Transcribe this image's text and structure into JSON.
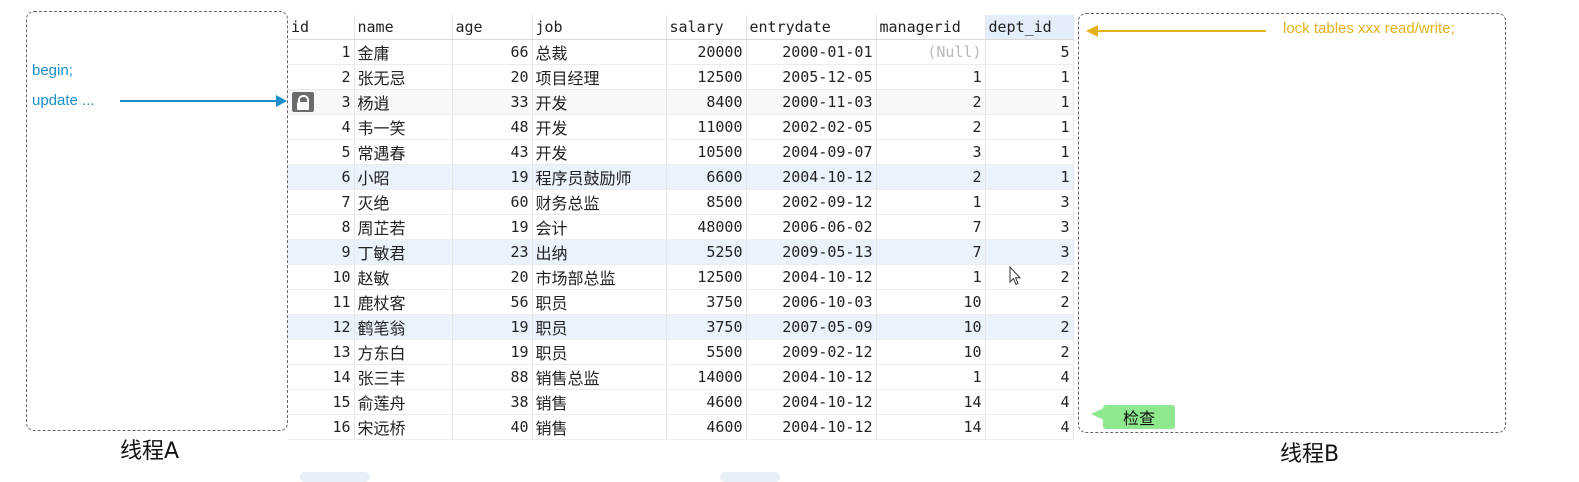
{
  "thread_a": {
    "label": "线程A",
    "commands": [
      "begin;",
      "update ..."
    ]
  },
  "thread_b": {
    "label": "线程B",
    "command": "lock tables xxx read/write;",
    "check_button": "检查"
  },
  "colors": {
    "blue": "#1a8fc9",
    "gold": "#e2b11c",
    "green": "#8ee88e"
  },
  "icons": {
    "row_lock": "lock-icon",
    "cursor": "mouse-pointer-icon"
  },
  "table": {
    "columns": [
      "id",
      "name",
      "age",
      "job",
      "salary",
      "entrydate",
      "managerid",
      "dept_id"
    ],
    "rows": [
      [
        "1",
        "金庸",
        "66",
        "总裁",
        "20000",
        "2000-01-01",
        "(Null)",
        "5"
      ],
      [
        "2",
        "张无忌",
        "20",
        "项目经理",
        "12500",
        "2005-12-05",
        "1",
        "1"
      ],
      [
        "3",
        "杨逍",
        "33",
        "开发",
        "8400",
        "2000-11-03",
        "2",
        "1"
      ],
      [
        "4",
        "韦一笑",
        "48",
        "开发",
        "11000",
        "2002-02-05",
        "2",
        "1"
      ],
      [
        "5",
        "常遇春",
        "43",
        "开发",
        "10500",
        "2004-09-07",
        "3",
        "1"
      ],
      [
        "6",
        "小昭",
        "19",
        "程序员鼓励师",
        "6600",
        "2004-10-12",
        "2",
        "1"
      ],
      [
        "7",
        "灭绝",
        "60",
        "财务总监",
        "8500",
        "2002-09-12",
        "1",
        "3"
      ],
      [
        "8",
        "周芷若",
        "19",
        "会计",
        "48000",
        "2006-06-02",
        "7",
        "3"
      ],
      [
        "9",
        "丁敏君",
        "23",
        "出纳",
        "5250",
        "2009-05-13",
        "7",
        "3"
      ],
      [
        "10",
        "赵敏",
        "20",
        "市场部总监",
        "12500",
        "2004-10-12",
        "1",
        "2"
      ],
      [
        "11",
        "鹿杖客",
        "56",
        "职员",
        "3750",
        "2006-10-03",
        "10",
        "2"
      ],
      [
        "12",
        "鹤笔翁",
        "19",
        "职员",
        "3750",
        "2007-05-09",
        "10",
        "2"
      ],
      [
        "13",
        "方东白",
        "19",
        "职员",
        "5500",
        "2009-02-12",
        "10",
        "2"
      ],
      [
        "14",
        "张三丰",
        "88",
        "销售总监",
        "14000",
        "2004-10-12",
        "1",
        "4"
      ],
      [
        "15",
        "俞莲舟",
        "38",
        "销售",
        "4600",
        "2004-10-12",
        "14",
        "4"
      ],
      [
        "16",
        "宋远桥",
        "40",
        "销售",
        "4600",
        "2004-10-12",
        "14",
        "4"
      ]
    ]
  }
}
